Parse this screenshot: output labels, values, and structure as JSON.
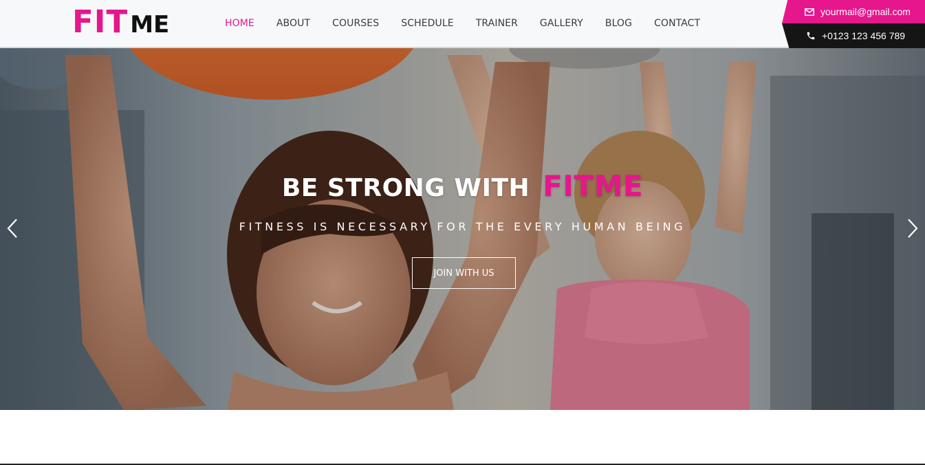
{
  "brand": {
    "logo_fit": "FIT",
    "logo_me": "ME"
  },
  "nav": {
    "items": [
      {
        "label": "HOME",
        "active": true
      },
      {
        "label": "ABOUT"
      },
      {
        "label": "COURSES"
      },
      {
        "label": "SCHEDULE"
      },
      {
        "label": "TRAINER"
      },
      {
        "label": "GALLERY"
      },
      {
        "label": "BLOG"
      },
      {
        "label": "CONTACT"
      }
    ]
  },
  "contact": {
    "email": "yourmail@gmail.com",
    "phone": "+0123 123 456 789",
    "email_icon": "envelope-icon",
    "phone_icon": "phone-icon"
  },
  "hero": {
    "title_prefix": "BE STRONG WITH",
    "title_accent": "FITME",
    "subtitle": "FITNESS IS NECESSARY FOR THE EVERY HUMAN BEING",
    "button_label": "JOIN WITH US",
    "prev_icon": "chevron-left-icon",
    "next_icon": "chevron-right-icon"
  },
  "colors": {
    "accent": "#e6168c",
    "dark": "#151515",
    "header_bg": "#f7f8fa"
  }
}
